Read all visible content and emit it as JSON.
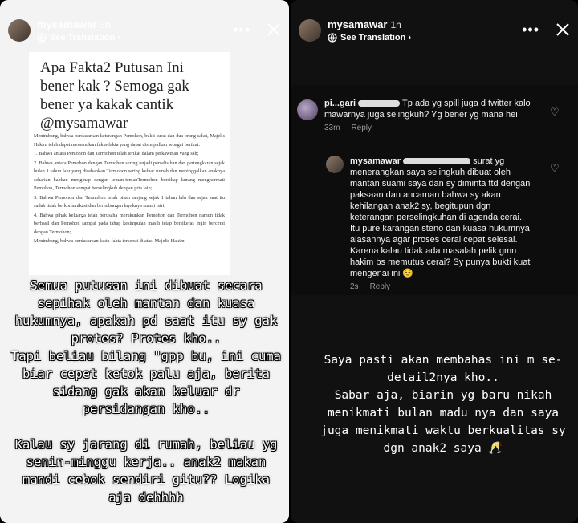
{
  "left_story": {
    "username": "mysamawar",
    "time": "3h",
    "see_translation": "See Translation",
    "document": {
      "question": "Apa Fakta2 Putusan Ini bener kak ? Semoga gak bener ya kakak cantik @mysamawar",
      "paragraphs": [
        "Menimbang, bahwa berdasarkan keterangan Pemohon, bukti surat dan dua orang saksi, Majelis Hakim telah dapat menemukan fakta-fakta yang dapat disimpulkan sebagai berikut:",
        "1. Bahwa antara Pemohon dan Termohon telah terikat dalam perkawinan yang sah;",
        "2. Bahwa antara Pemohon dengan Termohon sering terjadi perselisihan dan pertengkaran sejak bulan 1 tahun lalu yang disebabkan Termohon sering keluar rumah dan meninggalkan anaknya seharian bahkan menginap dengan teman-temanTermohon bersikap kurang menghormati Pemohon, Termohon sempat berselingkuh dengan pria lain;",
        "3. Bahwa Pemohon dan Termohon telah pisah ranjang sejak 1 tahun lalu dan sejak saat itu sudah tidak berkomunikasi dan berhubungan layaknya suami istri;",
        "4. Bahwa pihak keluarga telah berusaha merukunkan Pemohon dan Termohon namun tidak berhasil dan Pemohon sampai pada tahap kesimpulan masih tetap bersikeras ingin bercerai dengan Termohon;",
        "Menimbang, bahwa berdasarkan fakta-fakta tersebut di atas, Majelis Hakim"
      ]
    },
    "overlay_text": "Semua putusan ini dibuat secara sepihak oleh mantan dan kuasa hukumnya, apakah pd saat itu sy gak protes? Protes kho..\nTapi beliau bilang \"gpp bu, ini cuma biar cepet ketok palu aja, berita sidang gak akan keluar dr persidangan kho..\n\nKalau sy jarang di rumah, beliau yg senin-minggu kerja.. anak2 makan mandi cebok sendiri gitu?? Logika aja dehhhh"
  },
  "right_story": {
    "username": "mysamawar",
    "time": "1h",
    "see_translation": "See Translation",
    "comment1": {
      "username": "pi...gari",
      "text": "Tp ada yg spill juga d twitter kalo mawarnya juga selingkuh? Yg bener yg mana hei",
      "time": "33m",
      "reply": "Reply"
    },
    "comment2": {
      "username": "mysamawar",
      "text": "surat yg menerangkan saya selingkuh dibuat oleh mantan suami saya dan sy diminta ttd dengan paksaan dan ancaman bahwa sy akan kehilangan anak2 sy, begitupun dgn keterangan perselingkuhan di agenda cerai.. Itu pure karangan steno dan kuasa hukumnya alasannya agar proses cerai cepat selesai. Karena kalau tidak ada masalah pelik gmn hakim bs memutus cerai? Sy punya bukti kuat mengenai ini ☺️",
      "time": "2s",
      "reply": "Reply"
    },
    "overlay_text": "Saya pasti akan membahas ini m se-detail2nya kho..\nSabar aja, biarin yg baru nikah menikmati bulan madu nya dan saya juga menikmati waktu berkualitas sy dgn anak2 saya 🥂"
  }
}
